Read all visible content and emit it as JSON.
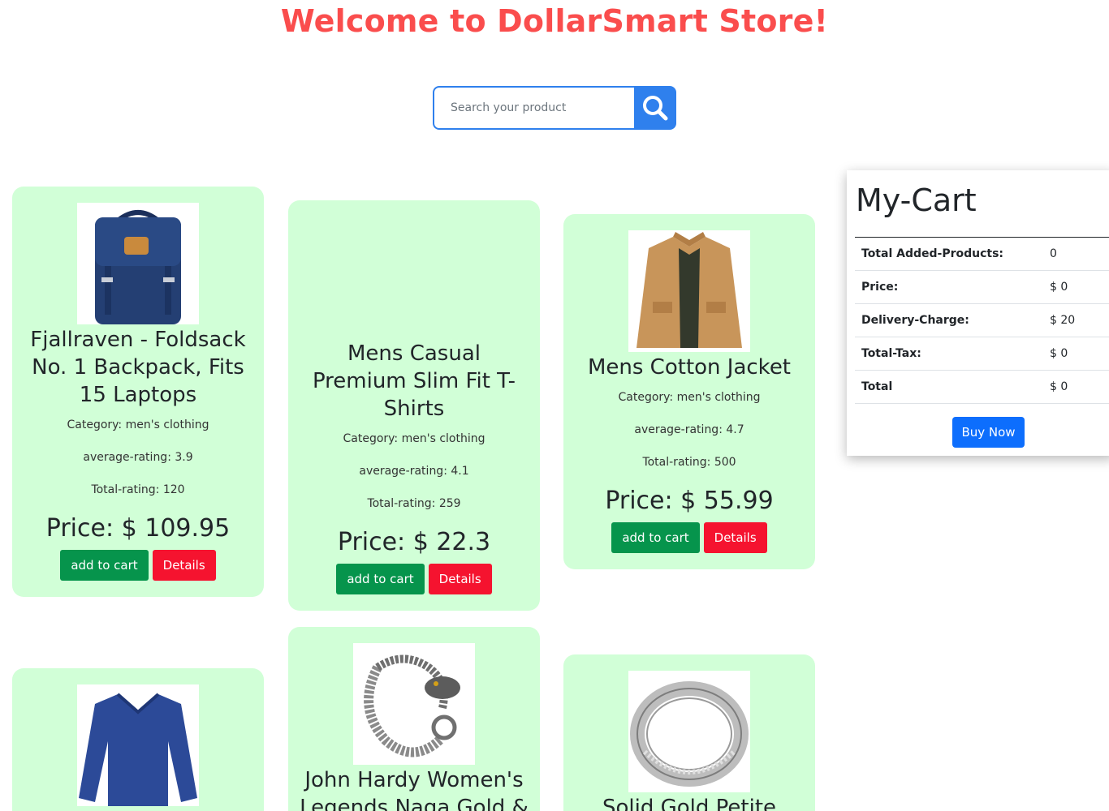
{
  "header": {
    "title": "Welcome to DollarSmart Store!"
  },
  "search": {
    "placeholder": "Search your product"
  },
  "labels": {
    "add_to_cart": "add to cart",
    "details": "Details"
  },
  "products": [
    {
      "name": "Fjallraven - Foldsack No. 1 Backpack, Fits 15 Laptops",
      "category": "Category: men's clothing",
      "avg_rating": "average-rating: 3.9",
      "total_rating": "Total-rating: 120",
      "price": "Price: $ 109.95"
    },
    {
      "name": "Mens Casual Premium Slim Fit T-Shirts",
      "category": "Category: men's clothing",
      "avg_rating": "average-rating: 4.1",
      "total_rating": "Total-rating: 259",
      "price": "Price: $ 22.3"
    },
    {
      "name": "Mens Cotton Jacket",
      "category": "Category: men's clothing",
      "avg_rating": "average-rating: 4.7",
      "total_rating": "Total-rating: 500",
      "price": "Price: $ 55.99"
    },
    {
      "name": ""
    },
    {
      "name": "John Hardy Women's Legends Naga Gold &"
    },
    {
      "name": "Solid Gold Petite"
    }
  ],
  "cart": {
    "title": "My-Cart",
    "rows": [
      {
        "label": "Total Added-Products:",
        "value": "0"
      },
      {
        "label": "Price:",
        "value": "$ 0"
      },
      {
        "label": "Delivery-Charge:",
        "value": "$ 20"
      },
      {
        "label": "Total-Tax:",
        "value": "$ 0"
      },
      {
        "label": "Total",
        "value": "$ 0"
      }
    ],
    "buy_label": "Buy Now"
  }
}
